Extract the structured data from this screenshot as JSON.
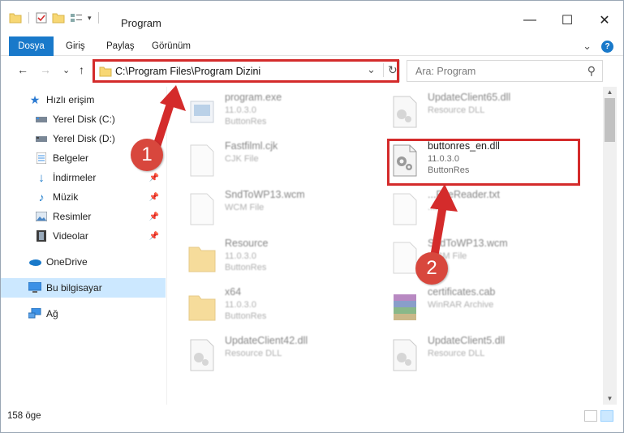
{
  "window": {
    "title": "Program",
    "controls": {
      "minimize": "—",
      "maximize": "☐",
      "close": "✕"
    }
  },
  "ribbon": {
    "tabs": [
      "Dosya",
      "Giriş",
      "Paylaş",
      "Görünüm"
    ],
    "help_label": "?",
    "collapse_glyph": "⌄"
  },
  "navigation": {
    "back_glyph": "←",
    "forward_glyph": "→",
    "recent_glyph": "⌄",
    "up_glyph": "↑",
    "address": "C:\\Program Files\\Program Dizini",
    "refresh_glyph": "↻",
    "dropdown_glyph": "⌄",
    "search_placeholder": "Ara: Program",
    "search_glyph": "⚲"
  },
  "sidebar": {
    "items": [
      {
        "label": "Hızlı erişim",
        "icon": "star-icon",
        "pinned": false
      },
      {
        "label": "Yerel Disk (C:)",
        "icon": "drive-icon",
        "pinned": false
      },
      {
        "label": "Yerel Disk (D:)",
        "icon": "drive-icon",
        "pinned": false
      },
      {
        "label": "Belgeler",
        "icon": "documents-icon",
        "pinned": true
      },
      {
        "label": "İndirmeler",
        "icon": "download-icon",
        "pinned": true
      },
      {
        "label": "Müzik",
        "icon": "music-icon",
        "pinned": true
      },
      {
        "label": "Resimler",
        "icon": "pictures-icon",
        "pinned": true
      },
      {
        "label": "Videolar",
        "icon": "video-icon",
        "pinned": true
      },
      {
        "label": "OneDrive",
        "icon": "cloud-icon",
        "pinned": false
      },
      {
        "label": "Bu bilgisayar",
        "icon": "computer-icon",
        "pinned": false,
        "selected": true
      },
      {
        "label": "Ağ",
        "icon": "network-icon",
        "pinned": false
      }
    ]
  },
  "files": [
    {
      "name": "program.exe",
      "meta1": "11.0.3.0",
      "meta2": "ButtonRes",
      "icon": "exe-icon"
    },
    {
      "name": "UpdateClient65.dll",
      "meta1": "Resource DLL",
      "meta2": "",
      "icon": "dll-icon"
    },
    {
      "name": "Fastfilml.cjk",
      "meta1": "CJK File",
      "meta2": "",
      "icon": "blank-file-icon"
    },
    {
      "name": "buttonres_en.dll",
      "meta1": "11.0.3.0",
      "meta2": "ButtonRes",
      "icon": "dll-icon"
    },
    {
      "name": "SndToWP13.wcm",
      "meta1": "WCM File",
      "meta2": "",
      "icon": "blank-file-icon"
    },
    {
      "name": "...FireReader.txt",
      "meta1": "...File",
      "meta2": "",
      "icon": "text-file-icon"
    },
    {
      "name": "Resource",
      "meta1": "11.0.3.0",
      "meta2": "ButtonRes",
      "icon": "folder-icon"
    },
    {
      "name": "SndToWP13.wcm",
      "meta1": "WCM File",
      "meta2": "",
      "icon": "blank-file-icon"
    },
    {
      "name": "x64",
      "meta1": "11.0.3.0",
      "meta2": "ButtonRes",
      "icon": "folder-icon"
    },
    {
      "name": "certificates.cab",
      "meta1": "WinRAR Archive",
      "meta2": "",
      "icon": "archive-icon"
    },
    {
      "name": "UpdateClient42.dll",
      "meta1": "Resource DLL",
      "meta2": "",
      "icon": "dll-icon"
    },
    {
      "name": "UpdateClient5.dll",
      "meta1": "Resource DLL",
      "meta2": "",
      "icon": "dll-icon"
    }
  ],
  "status": {
    "item_count": "158 öge"
  },
  "annotations": {
    "badge_1": "1",
    "badge_2": "2",
    "color": "#d42b2b"
  }
}
